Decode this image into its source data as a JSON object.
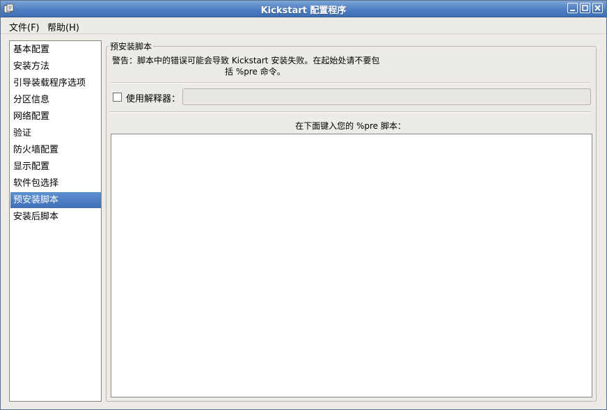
{
  "window": {
    "title": "Kickstart 配置程序",
    "icon": "kickstart-app-icon",
    "controls": [
      "minimize-icon",
      "maximize-icon",
      "close-icon"
    ]
  },
  "menubar": {
    "items": [
      {
        "label": "文件(F)"
      },
      {
        "label": "帮助(H)"
      }
    ]
  },
  "sidebar": {
    "items": [
      {
        "label": "基本配置"
      },
      {
        "label": "安装方法"
      },
      {
        "label": "引导装载程序选项"
      },
      {
        "label": "分区信息"
      },
      {
        "label": "网络配置"
      },
      {
        "label": "验证"
      },
      {
        "label": "防火墙配置"
      },
      {
        "label": "显示配置"
      },
      {
        "label": "软件包选择"
      },
      {
        "label": "预安装脚本"
      },
      {
        "label": "安装后脚本"
      }
    ],
    "selected": "预安装脚本"
  },
  "panel": {
    "title": "预安装脚本",
    "warning_line1": "警告：脚本中的错误可能会导致 Kickstart 安装失败。在起始处请不要包",
    "warning_line2": "括 %pre 命令。",
    "interpreter_label": "使用解释器：",
    "interpreter_checked": false,
    "interpreter_value": "",
    "script_label": "在下面键入您的 %pre 脚本：",
    "script_value": ""
  },
  "colors": {
    "titlebar": "#4f7fc2",
    "selection": "#4a7cc2",
    "background": "#edebe6"
  }
}
